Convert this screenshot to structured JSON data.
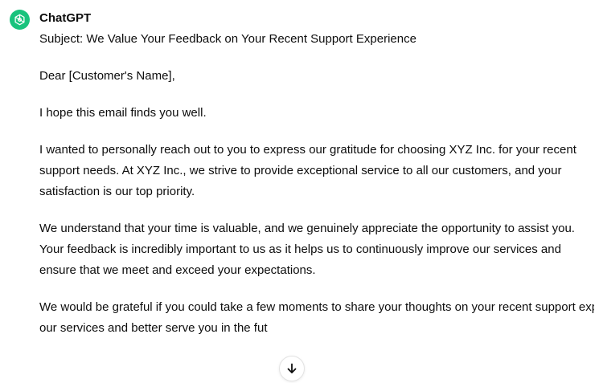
{
  "message": {
    "author": "ChatGPT",
    "avatar_icon": "openai-logo-icon",
    "avatar_color": "#19c37d",
    "paragraphs": [
      "Subject: We Value Your Feedback on Your Recent Support Experience",
      "Dear [Customer's Name],",
      "I hope this email finds you well.",
      "I wanted to personally reach out to you to express our gratitude for choosing XYZ Inc. for your recent support needs. At XYZ Inc., we strive to provide exceptional service to all our customers, and your satisfaction is our top priority.",
      "We understand that your time is valuable, and we genuinely appreciate the opportunity to assist you. Your feedback is incredibly important to us as it helps us to continuously improve our services and ensure that we meet and exceed your expectations.",
      "We would be grateful if you could take a few moments to share your thoughts on your recent support experience with us. Your input will enable us to identify any areas where we can enhance",
      "our services and better serve you in the fut"
    ]
  },
  "scroll_button": {
    "icon": "arrow-down-icon"
  }
}
